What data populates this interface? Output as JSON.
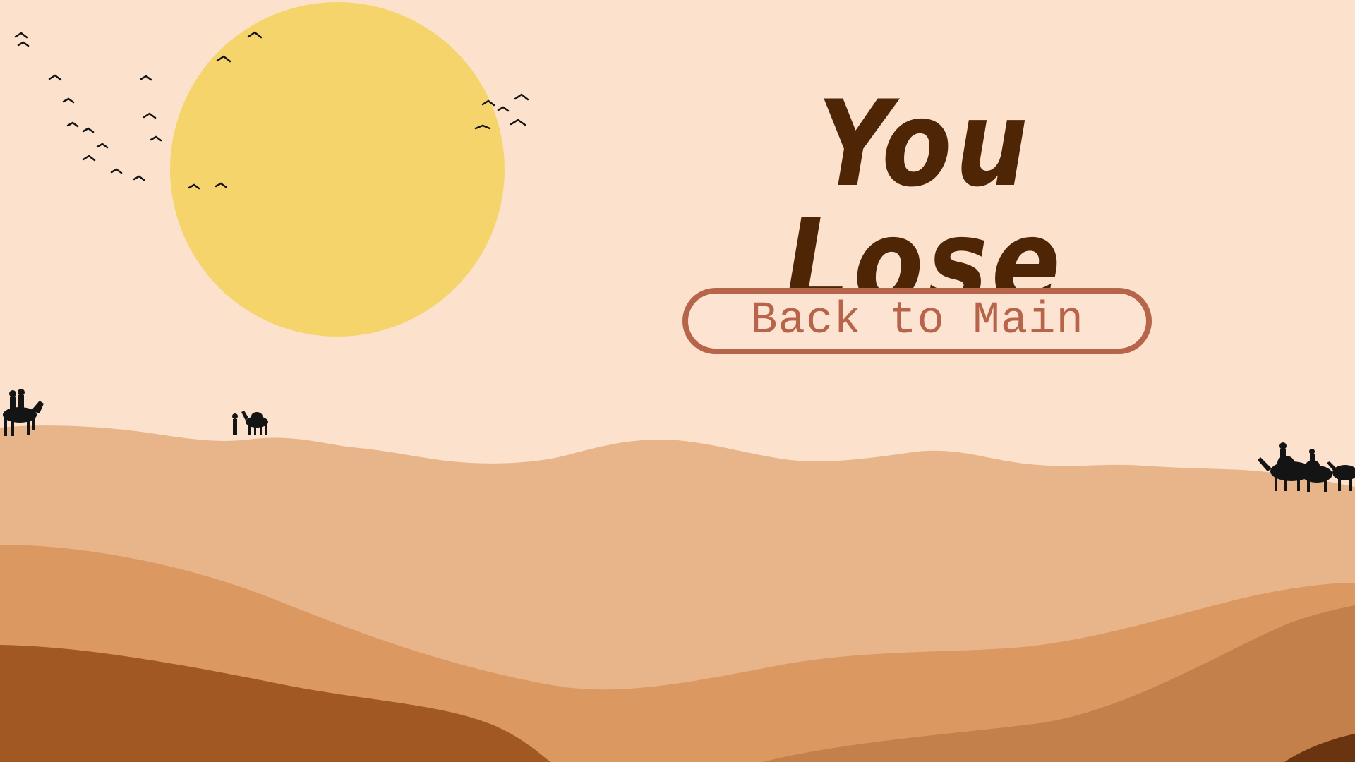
{
  "screen": {
    "title": "You Lose",
    "back_button_label": "Back to Main"
  },
  "colors": {
    "sky": "#fce1cd",
    "sun": "#f5d46c",
    "dune_far": "#e8b48a",
    "dune_mid": "#db9961",
    "dune_mid_right": "#c4804b",
    "dune_near": "#a15823",
    "dune_near_right": "#6b3410",
    "silhouette": "#141414",
    "title": "#4e2606",
    "button": "#b6654b"
  },
  "decorations": {
    "sun": "sun",
    "birds": "flock-of-birds",
    "riders": "horse-riders-silhouette",
    "camel_left": "camel-with-guide-silhouette",
    "caravan_right": "camel-caravan-silhouette"
  }
}
